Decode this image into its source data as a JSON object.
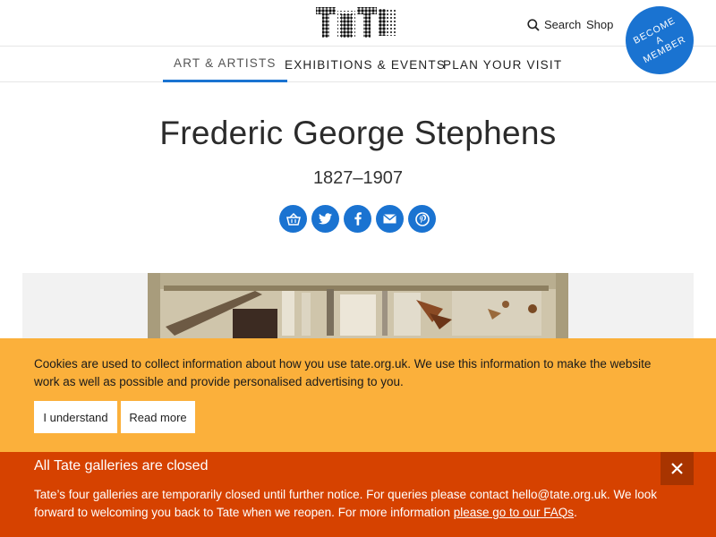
{
  "header": {
    "logo_text": "TATE",
    "search_label": "Search",
    "shop_label": "Shop",
    "member_badge": "BECOME A MEMBER",
    "accent_color": "#1a73d1"
  },
  "nav": {
    "items": [
      {
        "label": "ART & ARTISTS",
        "active": true
      },
      {
        "label": "EXHIBITIONS & EVENTS",
        "active": false
      },
      {
        "label": "PLAN YOUR VISIT",
        "active": false
      }
    ]
  },
  "artist": {
    "name": "Frederic George Stephens",
    "dates": "1827–1907"
  },
  "share": {
    "icons": [
      "basket-icon",
      "twitter-icon",
      "facebook-icon",
      "email-icon",
      "pinterest-icon"
    ]
  },
  "cookie": {
    "text": "Cookies are used to collect information about how you use tate.org.uk. We use this information to make the website work as well as possible and provide personalised advertising to you.",
    "accept_label": "I understand",
    "read_more_label": "Read more",
    "color": "#fbb03b"
  },
  "closure": {
    "title": "All Tate galleries are closed",
    "text_before": "Tate’s four galleries are temporarily closed until further notice. For queries please contact hello@tate.org.uk. We look forward to welcoming you back to Tate when we reopen. For more information ",
    "link_label": "please go to our FAQs",
    "text_after": ".",
    "close_label": "×",
    "color": "#d64200"
  }
}
